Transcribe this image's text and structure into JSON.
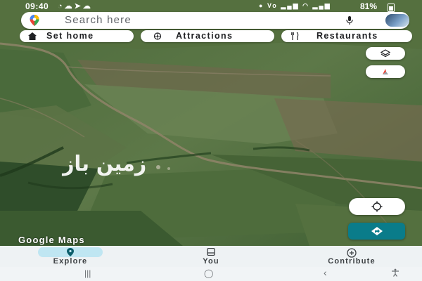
{
  "status_bar": {
    "time": "09:40",
    "left_icons": [
      "whatsapp-icon",
      "cloud-icon",
      "telegram-icon",
      "cloud-icon"
    ],
    "battery_percent": "81%",
    "right_icons": [
      "location-icon",
      "volte-icon",
      "signal-icon",
      "signal-icon",
      "wifi-icon"
    ]
  },
  "search": {
    "placeholder": "Search here",
    "logo_icon": "google-maps-logo-icon",
    "mic_icon": "mic-icon"
  },
  "chips": [
    {
      "label": "Set home",
      "icon": "home-icon"
    },
    {
      "label": "Attractions",
      "icon": "attractions-icon"
    },
    {
      "label": "Restaurants",
      "icon": "restaurant-icon"
    }
  ],
  "map": {
    "watermark_text": "زمین باز",
    "google_maps_label": "Google Maps",
    "accent_color": "#0a7c8a"
  },
  "bottom_nav": [
    {
      "label": "Explore",
      "icon": "location-pin-icon",
      "active": true
    },
    {
      "label": "You",
      "icon": "bookmark-icon",
      "active": false
    },
    {
      "label": "Contribute",
      "icon": "add-circle-icon",
      "active": false
    }
  ],
  "system_nav": {
    "recents": "|||",
    "home": "◯",
    "back": "‹",
    "accessibility": "accessibility-icon"
  }
}
